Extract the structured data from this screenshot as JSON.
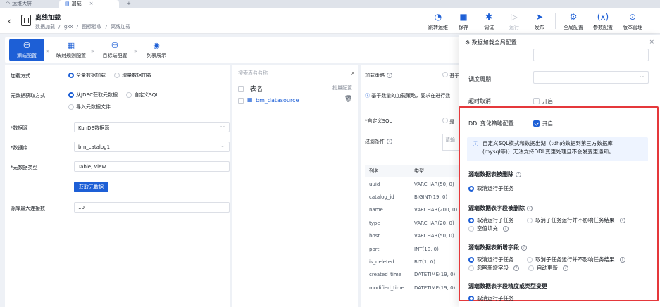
{
  "tabs": [
    {
      "label": "运维大屏",
      "icon": "gauge-icon"
    },
    {
      "label": "加载",
      "icon": "file-icon"
    }
  ],
  "header": {
    "title": "离线加载",
    "breadcrumb": [
      "数据加载",
      "gxx",
      "图标验收",
      "离线加载"
    ]
  },
  "toolbar": {
    "items": [
      {
        "label": "跳转运维",
        "icon": "gauge-icon"
      },
      {
        "label": "保存",
        "icon": "save-icon"
      },
      {
        "label": "调试",
        "icon": "bug-icon"
      },
      {
        "label": "运行",
        "icon": "play-icon",
        "disabled": true
      },
      {
        "label": "发布",
        "icon": "send-icon"
      },
      {
        "label": "全局配置",
        "icon": "gear-icon"
      },
      {
        "label": "参数配置",
        "icon": "variable-icon"
      },
      {
        "label": "版本管理",
        "icon": "version-icon"
      }
    ]
  },
  "steps": [
    {
      "label": "源端配置",
      "icon": "database-icon",
      "active": true
    },
    {
      "label": "映射规则配置",
      "icon": "grid-icon"
    },
    {
      "label": "目标端配置",
      "icon": "database-icon"
    },
    {
      "label": "列表展示",
      "icon": "eye-icon"
    }
  ],
  "form": {
    "load_mode_label": "加载方式",
    "load_mode_options": [
      "全量数据加载",
      "增量数据加载"
    ],
    "meta_source_label": "元数据获取方式",
    "meta_source_options": [
      "从JDBC获取元数据",
      "自定义SQL",
      "导入元数据文件"
    ],
    "datasource_label": "*数据源",
    "datasource_value": "KunDB数据源",
    "database_label": "*数据库",
    "database_value": "bm_catalog1",
    "meta_type_label": "*元数据类型",
    "meta_type_value": "Table, View",
    "fetch_button": "获取元数据",
    "max_conn_label": "源库最大连接数",
    "max_conn_value": "10"
  },
  "table_list": {
    "search_placeholder": "搜索表名名称",
    "header": "表名",
    "batch_label": "批量配置",
    "rows": [
      "bm_datasource"
    ]
  },
  "right": {
    "strategy_label": "加载策略",
    "strategy_option": "基于",
    "notice": "基于数量的加载策略，要求在进行数",
    "custom_sql_label": "*自定义SQL",
    "custom_sql_option": "是",
    "filter_label": "过滤条件",
    "filter_placeholder": "请输",
    "columns_header": [
      "列名",
      "类型"
    ],
    "columns": [
      [
        "uuid",
        "VARCHAR(50, 0)"
      ],
      [
        "catalog_id",
        "BIGINT(19, 0)"
      ],
      [
        "name",
        "VARCHAR(200, 0)"
      ],
      [
        "type",
        "VARCHAR(20, 0)"
      ],
      [
        "host",
        "VARCHAR(50, 0)"
      ],
      [
        "port",
        "INT(10, 0)"
      ],
      [
        "is_deleted",
        "BIT(1, 0)"
      ],
      [
        "created_time",
        "DATETIME(19, 0)"
      ],
      [
        "modified_time",
        "DATETIME(19, 0)"
      ]
    ]
  },
  "drawer": {
    "title": "数据加载全局配置",
    "schedule_label": "调度周期",
    "timeout_label": "超时取消",
    "timeout_toggle": "开启",
    "ddl_label": "DDL变化策略配置",
    "ddl_toggle": "开启",
    "info_line1": "自定义SQL模式和数据出湖（tdh的数据到第三方数据库",
    "info_line2": "(mysql等)）无法支持DDL变更处理且不会发变更通知。",
    "sections": [
      {
        "title": "源端数据表被删除",
        "options": [
          [
            "取消运行子任务"
          ]
        ]
      },
      {
        "title": "源端数据表字段被删除",
        "options": [
          [
            "取消运行子任务",
            "取消子任务运行并不影响任务结果"
          ],
          [
            "空值填充"
          ]
        ]
      },
      {
        "title": "源端数据表新增字段",
        "options": [
          [
            "取消运行子任务",
            "取消子任务运行并不影响任务结果"
          ],
          [
            "忽略新增字段",
            "自动更新"
          ]
        ]
      },
      {
        "title": "源端数据表字段精度或类型变更",
        "options": [
          [
            "取消运行子任务"
          ]
        ]
      }
    ]
  },
  "colors": {
    "accent": "#1d5fd6",
    "highlight_border": "#e5383b"
  }
}
